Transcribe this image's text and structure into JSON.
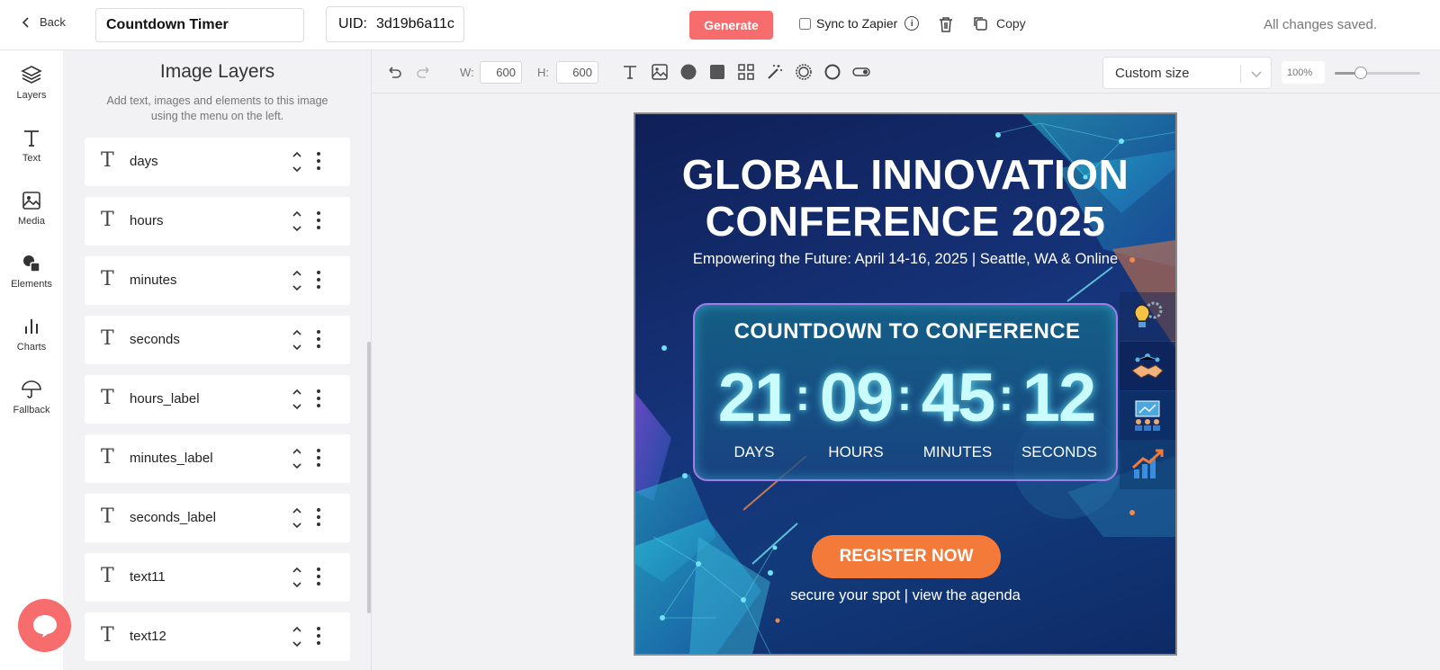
{
  "topbar": {
    "back_label": "Back",
    "title_value": "Countdown Timer",
    "uid_label": "UID:",
    "uid_value": "3d19b6a11c",
    "generate_label": "Generate",
    "sync_label": "Sync to Zapier",
    "info_glyph": "i",
    "copy_label": "Copy",
    "status": "All changes saved."
  },
  "nav": {
    "items": [
      {
        "label": "Layers",
        "icon": "layers-icon"
      },
      {
        "label": "Text",
        "icon": "text-icon"
      },
      {
        "label": "Media",
        "icon": "image-icon"
      },
      {
        "label": "Elements",
        "icon": "shapes-icon"
      },
      {
        "label": "Charts",
        "icon": "bar-chart-icon"
      },
      {
        "label": "Fallback",
        "icon": "umbrella-icon"
      }
    ]
  },
  "layers_panel": {
    "title": "Image Layers",
    "subtitle": "Add text, images and elements to this image using the menu on the left.",
    "type_glyph": "T",
    "items": [
      "days",
      "hours",
      "minutes",
      "seconds",
      "hours_label",
      "minutes_label",
      "seconds_label",
      "text11",
      "text12"
    ]
  },
  "toolbar": {
    "width_label": "W:",
    "width_value": "600",
    "height_label": "H:",
    "height_value": "600",
    "size_select": "Custom size",
    "zoom": "100%",
    "zoom_level": 0.3
  },
  "canvas": {
    "headline_1": "GLOBAL INNOVATION",
    "headline_2": "CONFERENCE 2025",
    "subline": "Empowering the Future: April 14-16, 2025 | Seattle, WA & Online",
    "countdown_title": "COUNTDOWN TO CONFERENCE",
    "days": "21",
    "hours": "09",
    "minutes": "45",
    "seconds": "12",
    "colon": ":",
    "days_label": "DAYS",
    "hours_label": "HOURS",
    "minutes_label": "MINUTES",
    "seconds_label": "SECONDS",
    "cta": "REGISTER NOW",
    "tagline": "secure your spot | view the agenda"
  },
  "colors": {
    "accent": "#f76d6d",
    "cta": "#f47a3a",
    "canvas_bg": "#16347a",
    "countdown_glow": "#c9fbff",
    "countdown_border": "#a07dea"
  }
}
